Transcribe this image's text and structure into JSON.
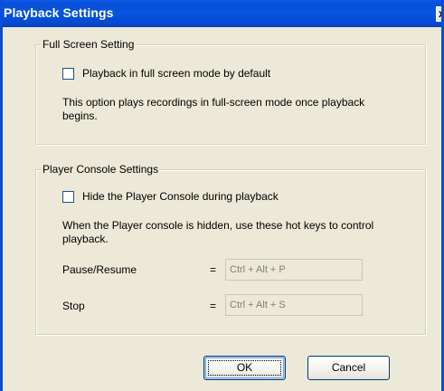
{
  "window": {
    "title": "Playback Settings",
    "close_glyph": "x"
  },
  "full_screen": {
    "group_label": "Full Screen Setting",
    "checkbox_label": "Playback in full screen mode by default",
    "checked": false,
    "description_line1": "This option plays recordings in full-screen mode once playback",
    "description_line2": "begins."
  },
  "player_console": {
    "group_label": "Player Console Settings",
    "checkbox_label": "Hide the Player Console during playback",
    "checked": false,
    "description_line1": "When the Player console is hidden, use these hot keys to control",
    "description_line2": "playback.",
    "hotkeys": [
      {
        "label": "Pause/Resume",
        "equals": "=",
        "value": "Ctrl + Alt + P"
      },
      {
        "label": "Stop",
        "equals": "=",
        "value": "Ctrl + Alt + S"
      }
    ]
  },
  "buttons": {
    "ok_label": "OK",
    "cancel_label": "Cancel"
  },
  "colors": {
    "title_bar": "#0a4fd4",
    "dialog_bg": "#ece9d8"
  }
}
